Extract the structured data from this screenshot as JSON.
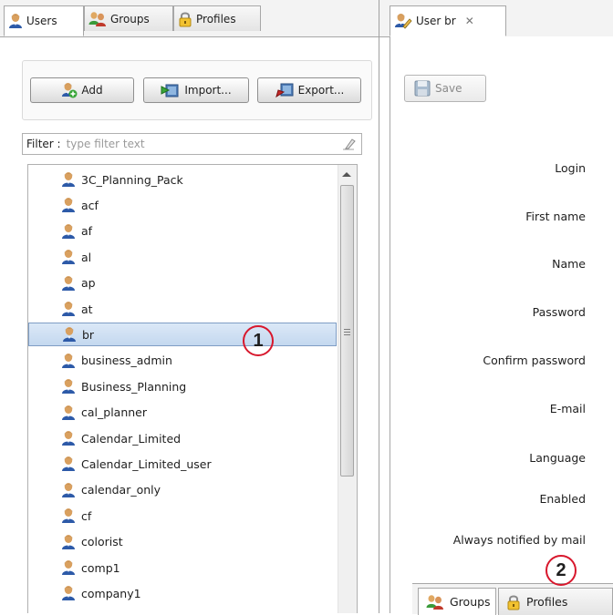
{
  "left_tabs": [
    {
      "label": "Users"
    },
    {
      "label": "Groups"
    },
    {
      "label": "Profiles"
    }
  ],
  "toolbar": {
    "add_label": "Add",
    "import_label": "Import...",
    "export_label": "Export..."
  },
  "filter": {
    "label": "Filter :",
    "placeholder": "type filter text"
  },
  "users": [
    "3C_Planning_Pack",
    "acf",
    "af",
    "al",
    "ap",
    "at",
    "br",
    "business_admin",
    "Business_Planning",
    "cal_planner",
    "Calendar_Limited",
    "Calendar_Limited_user",
    "calendar_only",
    "cf",
    "colorist",
    "comp1",
    "company1"
  ],
  "selected_user_index": 6,
  "editor": {
    "tab_label": "User br",
    "save_label": "Save",
    "fields": [
      "Login",
      "First name",
      "Name",
      "Password",
      "Confirm password",
      "E-mail",
      "Language",
      "Enabled",
      "Always notified by mail"
    ],
    "sub_tabs": [
      {
        "label": "Groups"
      },
      {
        "label": "Profiles"
      }
    ]
  },
  "markers": [
    "1",
    "2"
  ],
  "colors": {
    "selection_bg": "#c9dbf0",
    "marker_ring": "#d8182d",
    "panel_border": "#a7a7a7"
  },
  "icons": {
    "user": "user-icon",
    "group": "group-icon",
    "profile": "lock-icon",
    "add": "add-user-icon",
    "import": "import-icon",
    "export": "export-icon",
    "save": "floppy-disk-icon",
    "clear": "eraser-icon",
    "close": "close-icon"
  }
}
